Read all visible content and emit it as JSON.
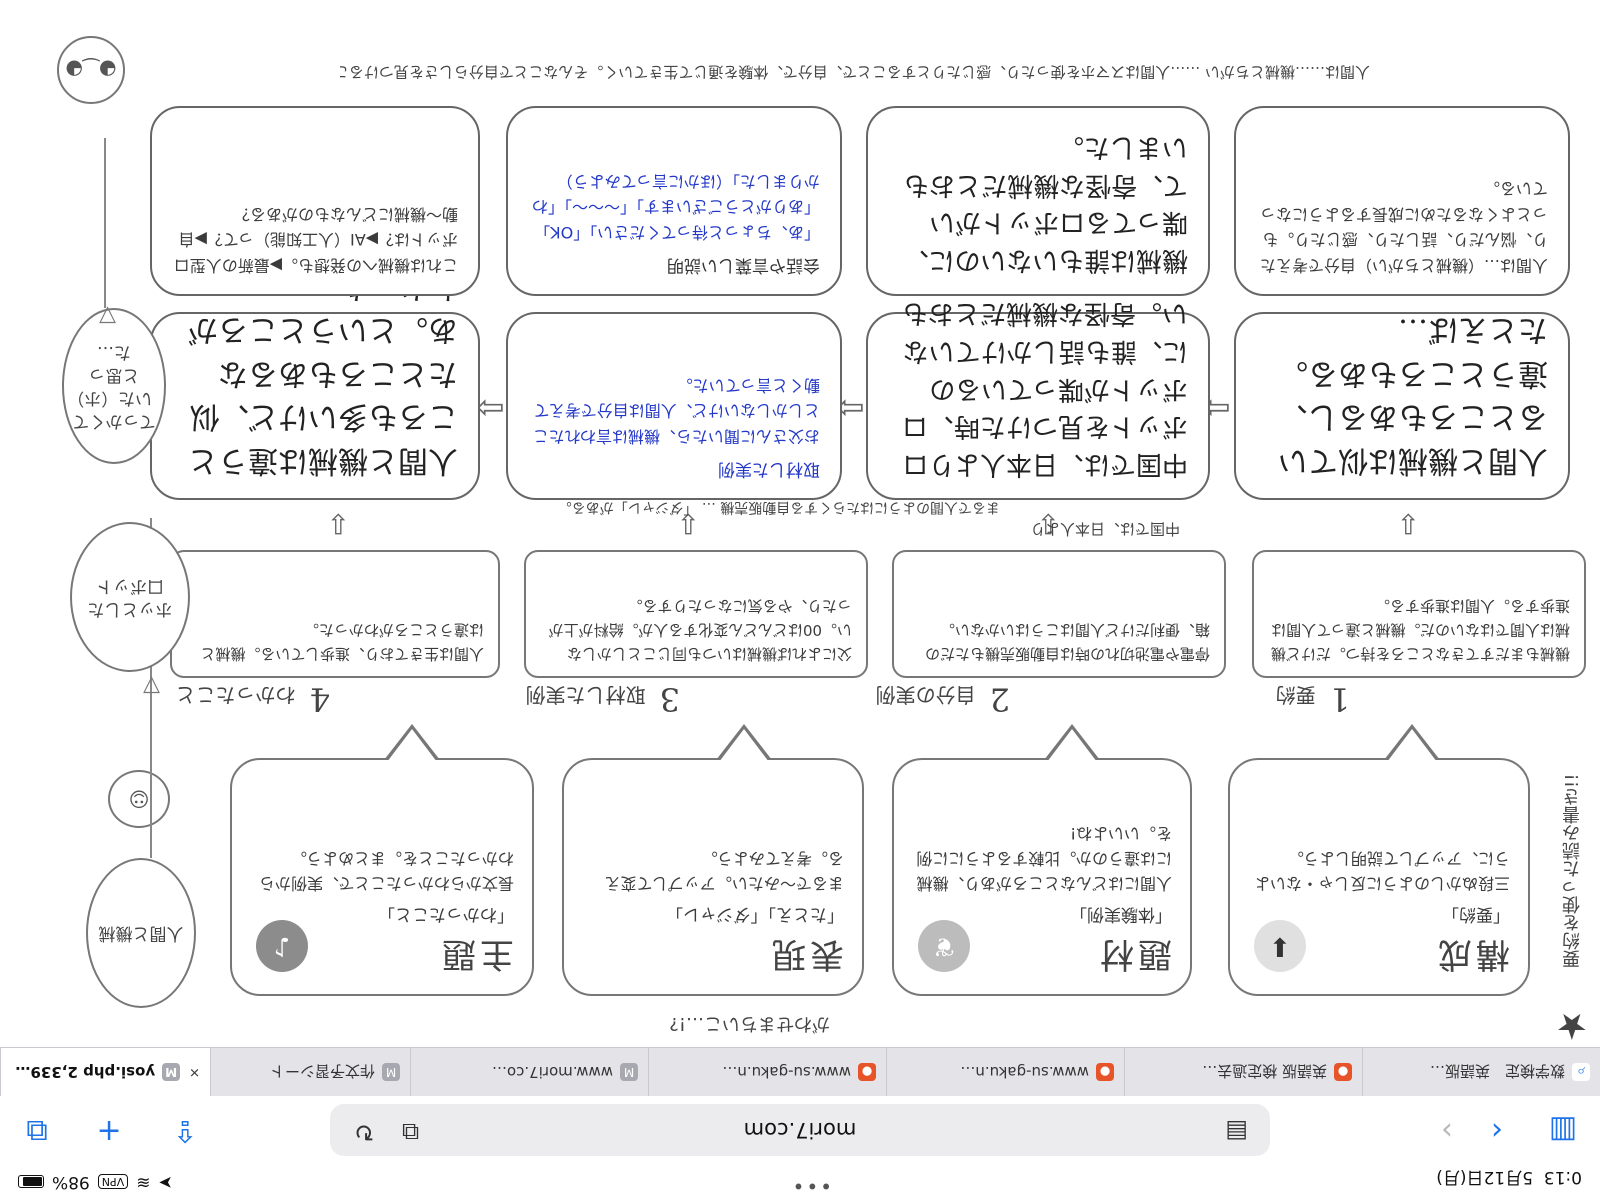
{
  "status_bar": {
    "time": "0:13",
    "date": "5月12日(月)",
    "center_dots": "•••",
    "vpn": "VPN",
    "battery": "98%"
  },
  "toolbar": {
    "url": "mori7.com",
    "icons": [
      "sidebar-icon",
      "back-icon",
      "forward-icon",
      "reader-icon",
      "extensions-icon",
      "reload-icon",
      "share-icon",
      "new-tab-icon",
      "tabs-icon"
    ]
  },
  "tabs": [
    {
      "label": "数学検定　英語版…",
      "favicon": "search"
    },
    {
      "label": "英語版 検定過去…",
      "favicon": "su-gaku"
    },
    {
      "label": "www.su-gaku.n…",
      "favicon": "su-gaku"
    },
    {
      "label": "www.su-gaku.n…",
      "favicon": "su-gaku"
    },
    {
      "label": "www.mori7.co…",
      "favicon": "M"
    },
    {
      "label": "作文予習シート",
      "favicon": "M"
    },
    {
      "label": "yosi.php 2,339…",
      "favicon": "M",
      "active": true
    }
  ],
  "worksheet": {
    "footer_note": "がわせまちいこ…!?",
    "side_note": "要約を使った読み書き!!",
    "bubbles": [
      {
        "title": "構成",
        "sub": "「要約」",
        "body": "三段ぬかしのように反しゃ・ないように、アップして説明しよう。"
      },
      {
        "title": "題材",
        "sub": "「体験実例」",
        "body": "人間にはどんなところがあり、機械には違うのか。比較するようにに例を。いいよね!"
      },
      {
        "title": "表現",
        "sub": "「たとえ」「ダジャレ」",
        "body": "まるで〜みたい。アップして変える。考えてみよう。"
      },
      {
        "title": "主題",
        "sub": "「わかったこと」",
        "body": "長文からわかったことで、実例からわかったことを。まとめよう。"
      }
    ],
    "steps": [
      {
        "num": "1",
        "label": "要約"
      },
      {
        "num": "2",
        "label": "自分の実例"
      },
      {
        "num": "3",
        "label": "取材した実例"
      },
      {
        "num": "4",
        "label": "わかったこと"
      }
    ],
    "examples": [
      "機械もまだすてきなところを持つ。だけど機械は人間ではないのだ。機械と違って人間は進歩する。人間は進歩する。",
      "停電や電池切れの時は自動販売機もただの箱、便利だけど人間はこうはいかない。",
      "父によれば機械はいつも同じことしかしない。00はどんどん変化する人が。給料が上がったり、やる気になったりする。",
      "人間は生きており、進歩している。機械とは違うところがわかった。"
    ],
    "arrow_captions": [
      "中国では、日本人より",
      "まるで人間のようにはたらくする自動販売機 … 「ダジャレ」がある。"
    ],
    "big_boxes": [
      {
        "text": "人間と機械は似ているところもあるし、違うところもある。たとえば…"
      },
      {
        "text": "中国では、日本人よりロボットを見つけた時、ロボットが喋っているのに、誰も話しかけていない。奇怪な機械だとおもいました。"
      },
      {
        "title": "取材した実例",
        "text": "お父さんに聞いたら、機械は言われたことしかしないけど、人間は自分で考えて動くと言っていた。"
      },
      {
        "text": "人間と機械は違うところも多いけど、似たところもあるなあ。というところがわかった。"
      }
    ],
    "upper_boxes": [
      {
        "text": "人間は…（機械とちがい）自分で考えたり、悩んだり、話したり、感じたり。もっとよくなるために成長するようになっている。"
      },
      {
        "text": "機械は誰もいないのに、喋ってるロボットがいて、奇怪な機械だとおもいました。"
      },
      {
        "title": "会話や言葉しい説明",
        "text": "「あ、ちょっと待ってください」「OK」「ありがとうございます」「〜〜〜」「わかりました」（ほかに言ってみよう）"
      },
      {
        "text": "これは機械への発想も。▶最新の人型ロボットは？▶AI（人工知能）って？▶自動〜機械にどんなものがある？"
      }
    ],
    "ovals": [
      "人間と機械",
      "ホッとした口ボット",
      "てっかくていた（ホ）と思った…"
    ],
    "top_note": "人間は……機械とちがい ……人間はスマホを使ったり、感じたりとすることで、自分で、体験を通じて生きていく。そんなことで自分らしさを見つけることでしかわからないものは。"
  }
}
